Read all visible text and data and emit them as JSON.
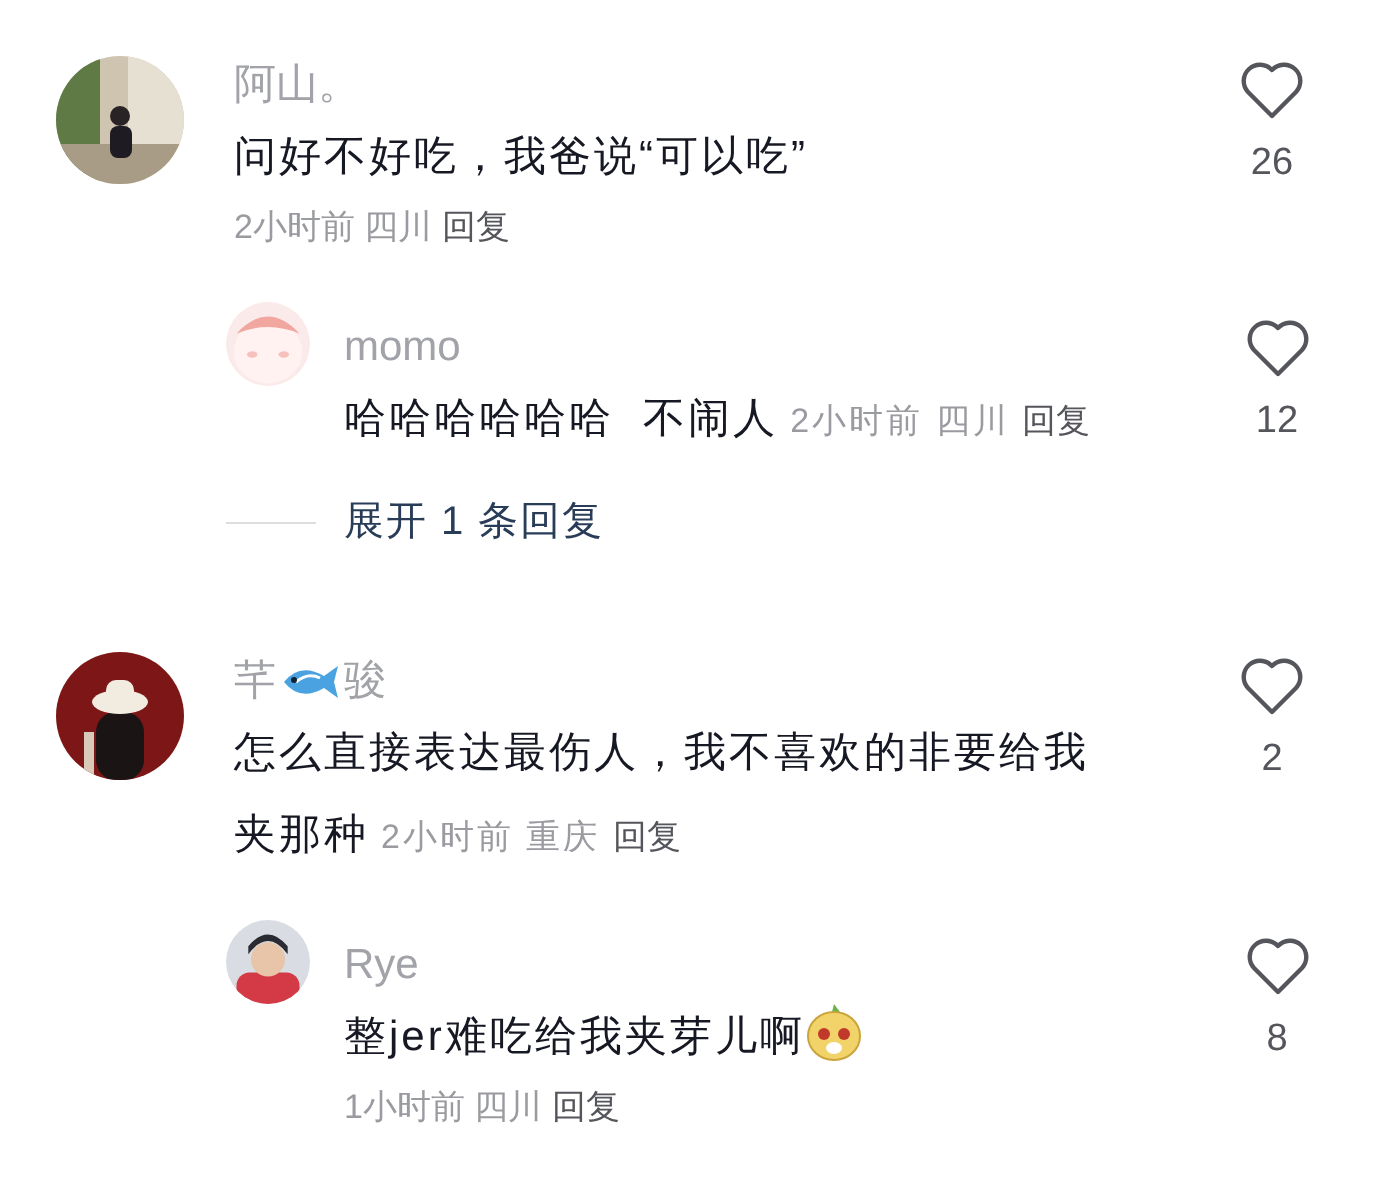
{
  "comments": [
    {
      "name": [
        {
          "kind": "text",
          "text": "阿山。"
        }
      ],
      "lines": [
        [
          {
            "kind": "text",
            "text": "问好不好吃，我爸说“可以吃”"
          }
        ]
      ],
      "meta_inline": false,
      "time": "2小时前",
      "location": "四川",
      "reply_label": "回复",
      "likes": "26",
      "liked": false,
      "replies": [
        {
          "name": [
            {
              "kind": "text",
              "text": "momo"
            }
          ],
          "lines": [
            [
              {
                "kind": "text",
                "text": "哈哈哈哈哈哈  不闹人"
              }
            ]
          ],
          "meta_inline": true,
          "time": "2小时前",
          "location": "四川",
          "reply_label": "回复",
          "likes": "12",
          "liked": false
        }
      ],
      "expand_label": "展开 1 条回复"
    },
    {
      "name": [
        {
          "kind": "text",
          "text": "芊"
        },
        {
          "kind": "emoji"
        },
        {
          "kind": "text",
          "text": "骏"
        }
      ],
      "lines": [
        [
          {
            "kind": "text",
            "text": "怎么直接表达最伤人，我不喜欢的非要给我"
          }
        ],
        [
          {
            "kind": "text",
            "text": "夹那种"
          }
        ]
      ],
      "meta_inline": true,
      "time": "2小时前",
      "location": "重庆",
      "reply_label": "回复",
      "likes": "2",
      "liked": false,
      "replies": [
        {
          "name": [
            {
              "kind": "text",
              "text": "Rye"
            }
          ],
          "lines": [
            [
              {
                "kind": "text",
                "text": "整jer难吃给我夹芽儿啊"
              },
              {
                "kind": "emoji"
              }
            ]
          ],
          "meta_inline": false,
          "time": "1小时前",
          "location": "四川",
          "reply_label": "回复",
          "likes": "8",
          "liked": false
        }
      ]
    }
  ]
}
